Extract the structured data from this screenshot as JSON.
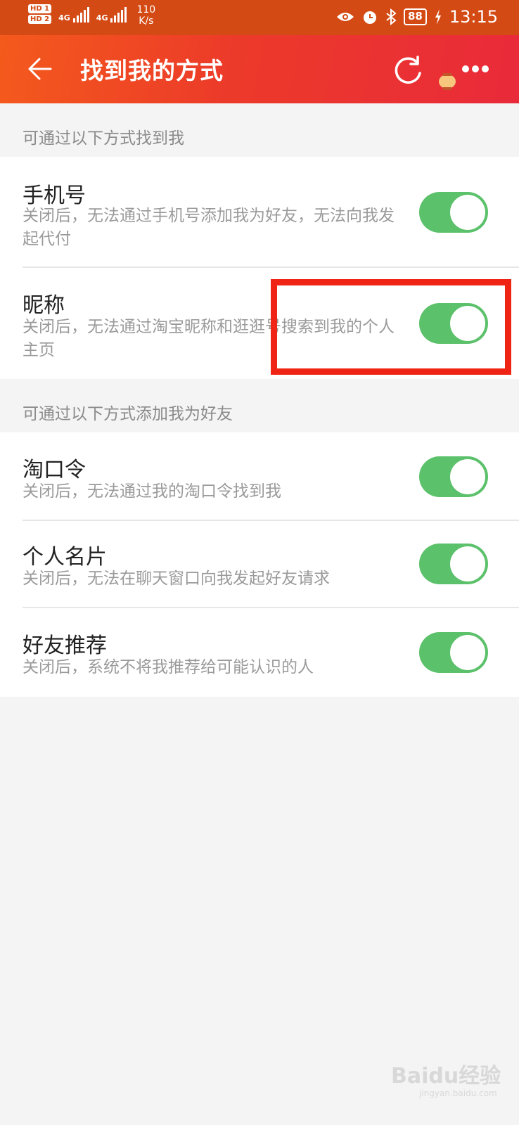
{
  "status_bar": {
    "sim1_badge": "HD 1",
    "sim2_badge": "HD 2",
    "network1": "4G",
    "network2": "4G",
    "speed_value": "110",
    "speed_unit": "K/s",
    "battery": "88",
    "time": "13:15",
    "icons": [
      "eye-icon",
      "alarm-icon",
      "bluetooth-icon",
      "charging-icon"
    ]
  },
  "header": {
    "title": "找到我的方式",
    "back_icon": "arrow-left-icon",
    "refresh_icon": "refresh-icon",
    "more_icon": "more-dots-icon",
    "bg_colors": [
      "#f45a1c",
      "#e92a3a"
    ]
  },
  "sections": [
    {
      "header": "可通过以下方式找到我",
      "items": [
        {
          "title": "手机号",
          "description": "关闭后，无法通过手机号添加我为好友，无法向我发起代付",
          "enabled": true
        },
        {
          "title": "昵称",
          "description": "关闭后，无法通过淘宝昵称和逛逛号搜索到我的个人主页",
          "enabled": true
        }
      ]
    },
    {
      "header": "可通过以下方式添加我为好友",
      "items": [
        {
          "title": "淘口令",
          "description": "关闭后，无法通过我的淘口令找到我",
          "enabled": true
        },
        {
          "title": "个人名片",
          "description": "关闭后，无法在聊天窗口向我发起好友请求",
          "enabled": true
        },
        {
          "title": "好友推荐",
          "description": "关闭后，系统不将我推荐给可能认识的人",
          "enabled": true
        }
      ]
    }
  ],
  "toggle_color": "#5cc16b",
  "annotation_color": "#f02414",
  "watermark": {
    "text": "Baidu经验",
    "sub": "jingyan.baidu.com"
  }
}
